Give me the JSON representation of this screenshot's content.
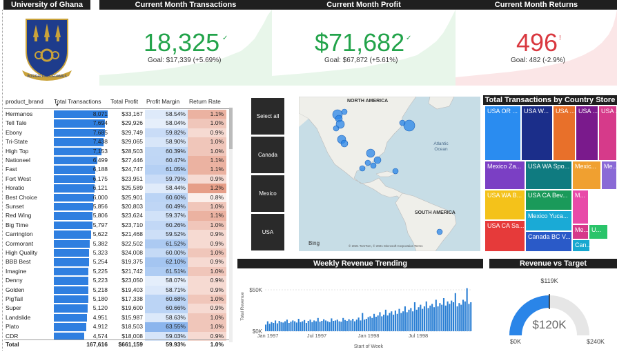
{
  "headers": {
    "university": "University of Ghana",
    "transactions": "Current Month Transactions",
    "profit": "Current Month Profit",
    "returns": "Current Month Returns",
    "treemap": "Total Transactions by Country Store",
    "weekly": "Weekly Revenue Trending",
    "target": "Revenue vs Target"
  },
  "logo": {
    "motto": "INTEGRI PROCEDAMUS",
    "colors": {
      "shield": "#1e3c8c",
      "gold": "#c9a23a"
    }
  },
  "kpis": {
    "transactions": {
      "value": "18,325",
      "goal": "Goal: $17,339 (+5.69%)",
      "color": "#22a34a",
      "level": 0.8
    },
    "profit": {
      "value": "$71,682",
      "goal": "Goal: $67,872 (+5.61%)",
      "color": "#22a34a",
      "level": 0.8
    },
    "returns": {
      "value": "496",
      "goal": "Goal: 482 (-2.9%)",
      "color": "#d9383f",
      "level": 0.8
    }
  },
  "table": {
    "columns": [
      "product_brand",
      "Total Transactions",
      "Total Profit",
      "Profit Margin",
      "Return Rate"
    ],
    "max_transactions": 8071,
    "rows": [
      [
        "Hermanos",
        8071,
        "$33,167",
        "58.54%",
        "1.1%"
      ],
      [
        "Tell Tale",
        7694,
        "$29,926",
        "58.04%",
        "1.0%"
      ],
      [
        "Ebony",
        7685,
        "$29,749",
        "59.82%",
        "0.9%"
      ],
      [
        "Tri-State",
        7438,
        "$29,065",
        "58.90%",
        "1.0%"
      ],
      [
        "High Top",
        7153,
        "$28,503",
        "60.39%",
        "1.0%"
      ],
      [
        "Nationeel",
        6499,
        "$27,446",
        "60.47%",
        "1.1%"
      ],
      [
        "Fast",
        6188,
        "$24,747",
        "61.05%",
        "1.1%"
      ],
      [
        "Fort West",
        6175,
        "$23,951",
        "59.79%",
        "0.9%"
      ],
      [
        "Horatio",
        6121,
        "$25,589",
        "58.44%",
        "1.2%"
      ],
      [
        "Best Choice",
        6000,
        "$25,901",
        "60.60%",
        "0.8%"
      ],
      [
        "Sunset",
        5856,
        "$20,803",
        "60.49%",
        "1.0%"
      ],
      [
        "Red Wing",
        5806,
        "$23,624",
        "59.37%",
        "1.1%"
      ],
      [
        "Big Time",
        5797,
        "$23,710",
        "60.26%",
        "1.0%"
      ],
      [
        "Carrington",
        5622,
        "$21,468",
        "59.52%",
        "0.9%"
      ],
      [
        "Cormorant",
        5382,
        "$22,502",
        "61.52%",
        "0.9%"
      ],
      [
        "High Quality",
        5323,
        "$24,008",
        "60.00%",
        "1.0%"
      ],
      [
        "BBB Best",
        5254,
        "$19,375",
        "62.10%",
        "0.9%"
      ],
      [
        "Imagine",
        5225,
        "$21,742",
        "61.51%",
        "1.0%"
      ],
      [
        "Denny",
        5223,
        "$23,050",
        "58.07%",
        "0.9%"
      ],
      [
        "Golden",
        5218,
        "$19,403",
        "58.71%",
        "0.9%"
      ],
      [
        "PigTail",
        5180,
        "$17,338",
        "60.68%",
        "1.0%"
      ],
      [
        "Super",
        5120,
        "$19,600",
        "60.66%",
        "0.9%"
      ],
      [
        "Landslide",
        4951,
        "$15,987",
        "58.63%",
        "1.0%"
      ],
      [
        "Plato",
        4912,
        "$18,503",
        "63.55%",
        "1.0%"
      ],
      [
        "CDR",
        4574,
        "$18,008",
        "59.03%",
        "0.9%"
      ]
    ],
    "total": [
      "Total",
      "167,616",
      "$661,159",
      "59.93%",
      "1.0%"
    ]
  },
  "slicer": [
    "Select all",
    "Canada",
    "Mexico",
    "USA"
  ],
  "map": {
    "labels": [
      "NORTH AMERICA",
      "SOUTH AMERICA",
      "Atlantic",
      "Ocean"
    ],
    "brand": "Bing",
    "copyright": "© 2021 TomTom, © 2021 Microsoft Corporation  Terms"
  },
  "treemap": [
    {
      "label": "USA OR ...",
      "color": "#2a8cf0"
    },
    {
      "label": "USA W...",
      "color": "#1b2e8a"
    },
    {
      "label": "USA ...",
      "color": "#e8702a"
    },
    {
      "label": "USA ...",
      "color": "#7a1a8c"
    },
    {
      "label": "USA ...",
      "color": "#d63a8a"
    },
    {
      "label": "Mexico Za...",
      "color": "#7b3fc4"
    },
    {
      "label": "USA WA Spo...",
      "color": "#0f7b80"
    },
    {
      "label": "Mexic...",
      "color": "#f0a030"
    },
    {
      "label": "Me...",
      "color": "#8a6ad6"
    },
    {
      "label": "USA WA B...",
      "color": "#f4c21a"
    },
    {
      "label": "USA CA Bev...",
      "color": "#1a9a5a"
    },
    {
      "label": "M...",
      "color": "#e84aa8"
    },
    {
      "label": "USA CA Sa...",
      "color": "#e63a3a"
    },
    {
      "label": "Mexico Yuca...",
      "color": "#1aaad6"
    },
    {
      "label": "Canada BC V...",
      "color": "#2a5ac8"
    },
    {
      "label": "Me...",
      "color": "#d63a8a"
    },
    {
      "label": "U...",
      "color": "#2ac46a"
    },
    {
      "label": "Can...",
      "color": "#18a8d0"
    }
  ],
  "weekly": {
    "y_label": "Total Revenue",
    "x_label": "Start of Week",
    "y_ticks": [
      "$50K",
      "$0K"
    ],
    "x_ticks": [
      "Jan 1997",
      "Jul 1997",
      "Jan 1998",
      "Jul 1998"
    ],
    "color": "#2a7fd4"
  },
  "gauge": {
    "value": "$120K",
    "min": "$0K",
    "max": "$240K",
    "target": "$119K",
    "fraction": 0.5,
    "color": "#2a85e8"
  },
  "chart_data": {
    "type": "bar",
    "title": "Weekly Revenue Trending",
    "xlabel": "Start of Week",
    "ylabel": "Total Revenue",
    "ylim": [
      0,
      60000
    ],
    "x_ticks": [
      "Jan 1997",
      "Jul 1997",
      "Jan 1998",
      "Jul 1998"
    ],
    "values": [
      8000,
      12000,
      9000,
      11000,
      10000,
      13000,
      9500,
      12500,
      11000,
      10500,
      12000,
      14000,
      10000,
      11500,
      13000,
      12000,
      10500,
      15000,
      11000,
      12000,
      13500,
      10000,
      12500,
      14000,
      11000,
      13000,
      12000,
      16000,
      11500,
      12500,
      14500,
      13000,
      12000,
      11000,
      15500,
      12500,
      13000,
      14000,
      12000,
      11500,
      16000,
      13500,
      12500,
      14500,
      13000,
      15000,
      12000,
      14000,
      16500,
      13000,
      22000,
      14000,
      15000,
      17000,
      18000,
      16000,
      21000,
      17500,
      19000,
      23000,
      18000,
      20000,
      26000,
      19000,
      22000,
      24000,
      20000,
      25000,
      21000,
      27000,
      22000,
      24000,
      30000,
      23000,
      26000,
      28000,
      24000,
      35000,
      26000,
      29000,
      32000,
      27000,
      30000,
      36000,
      28000,
      31000,
      33000,
      29000,
      38000,
      30000,
      34000,
      32000,
      40000,
      31000,
      36000,
      33000,
      37000,
      35000,
      46000,
      30000,
      34000,
      32000,
      38000,
      36000,
      52000,
      33000,
      35000
    ]
  }
}
